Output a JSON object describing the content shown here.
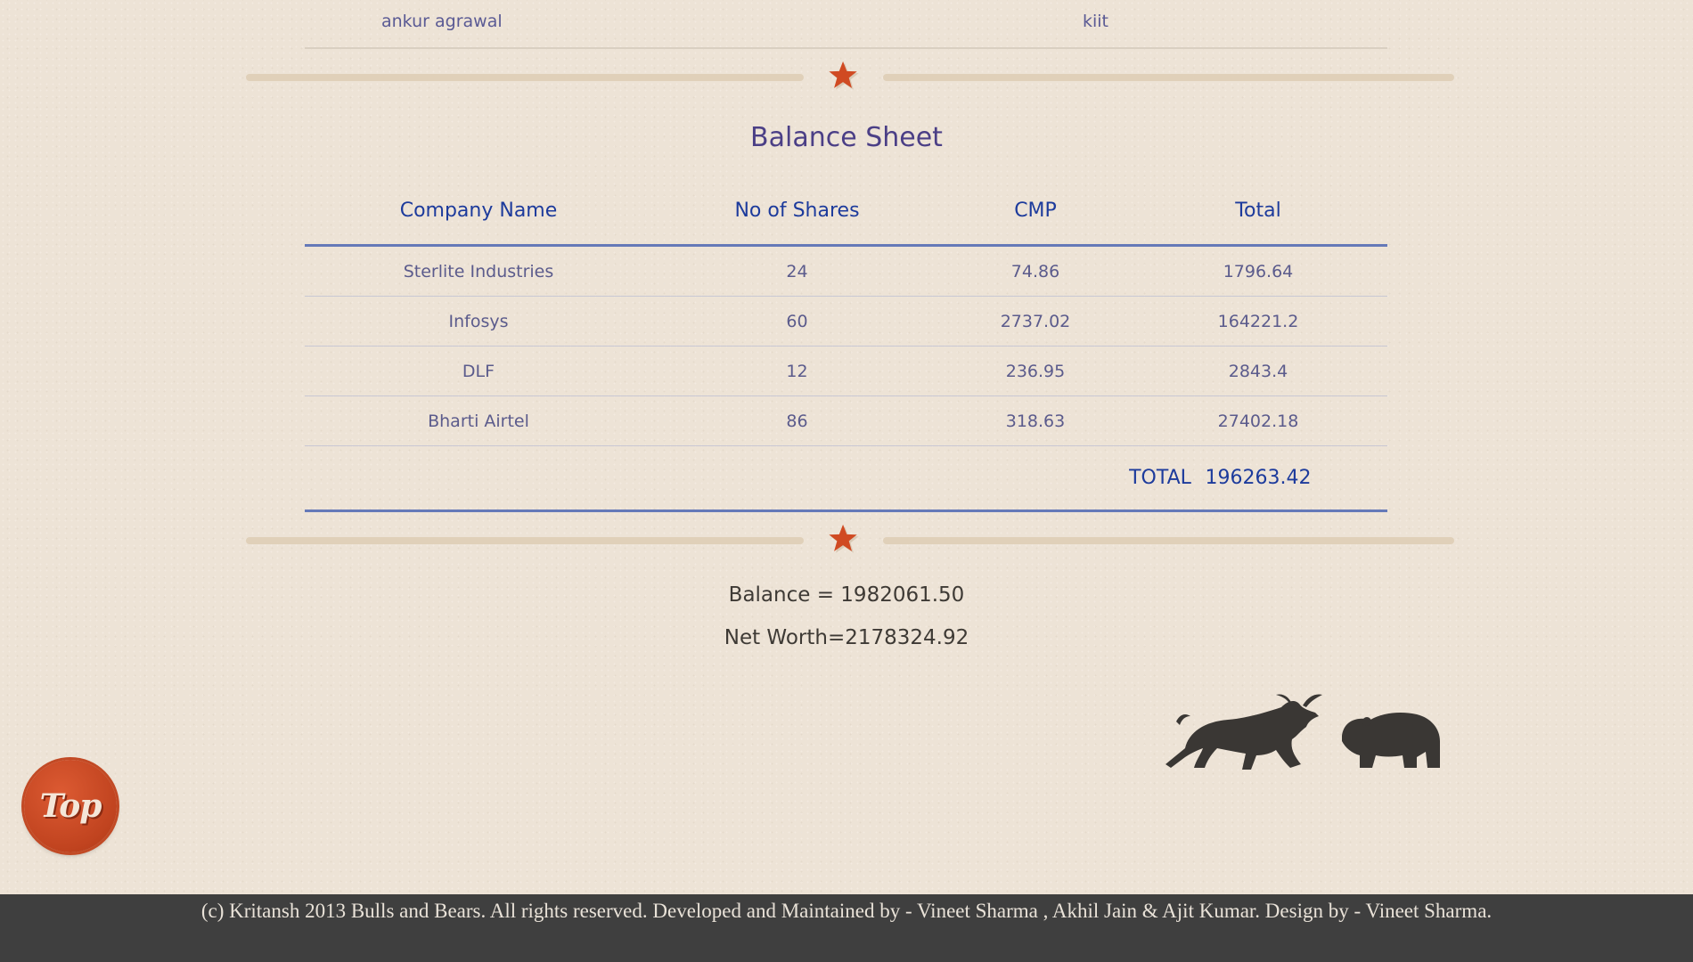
{
  "profile": {
    "name": "ankur agrawal",
    "institute": "kiit"
  },
  "balance_sheet": {
    "title": "Balance Sheet",
    "columns": [
      "Company Name",
      "No of Shares",
      "CMP",
      "Total"
    ],
    "rows": [
      {
        "company": "Sterlite Industries",
        "shares": "24",
        "cmp": "74.86",
        "total": "1796.64"
      },
      {
        "company": "Infosys",
        "shares": "60",
        "cmp": "2737.02",
        "total": "164221.2"
      },
      {
        "company": "DLF",
        "shares": "12",
        "cmp": "236.95",
        "total": "2843.4"
      },
      {
        "company": "Bharti Airtel",
        "shares": "86",
        "cmp": "318.63",
        "total": "27402.18"
      }
    ],
    "total_label": "TOTAL",
    "total_value": "196263.42"
  },
  "summary": {
    "balance": "Balance = 1982061.50",
    "net_worth": "Net Worth=2178324.92"
  },
  "top_button": {
    "label": "Top"
  },
  "icons": {
    "divider": "star-icon",
    "logo": "bull-and-bear-icon"
  },
  "colors": {
    "accent_star": "#d04a22",
    "header_text": "#1d3b9c",
    "title_text": "#4b3f86",
    "footer_bg": "#3f3f3f"
  },
  "footer": {
    "text": "(c) Kritansh 2013 Bulls and Bears. All rights reserved. Developed and Maintained by - Vineet Sharma , Akhil Jain & Ajit Kumar. Design by - Vineet Sharma."
  }
}
